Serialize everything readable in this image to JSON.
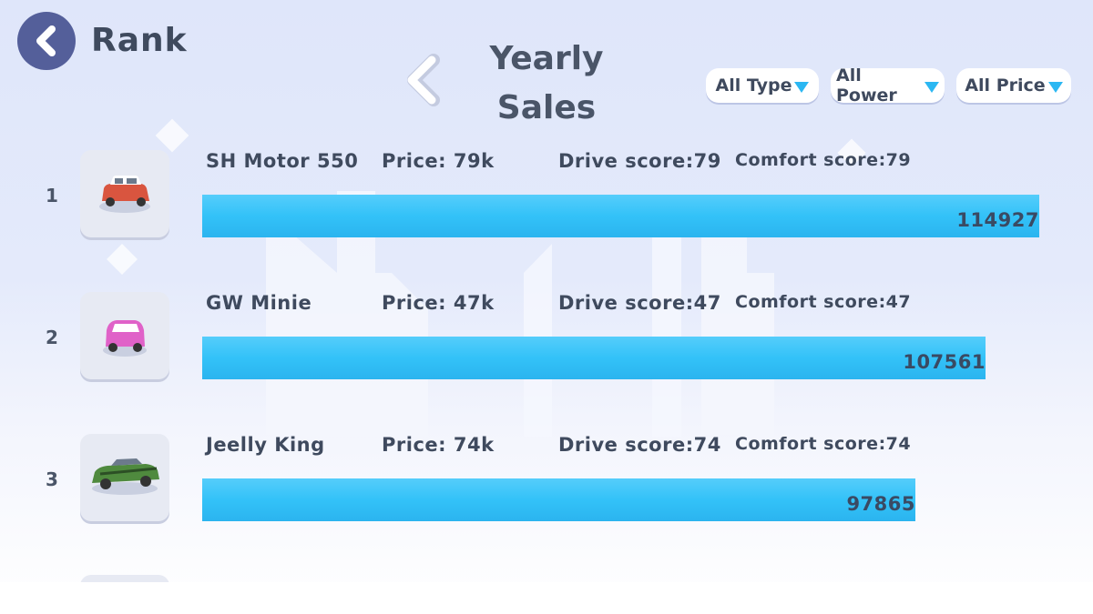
{
  "header": {
    "title": "Rank",
    "category_title": "Yearly Sales"
  },
  "filters": [
    {
      "label": "All Type"
    },
    {
      "label": "All Power"
    },
    {
      "label": "All Price"
    }
  ],
  "ranking": [
    {
      "rank": "1",
      "name": "SH Motor 550",
      "price": "Price: 79k",
      "drive": "Drive score:79",
      "comfort": "Comfort score:79",
      "sales": "114927",
      "sales_value": 114927,
      "car_icon": "red-mini-car-icon",
      "car_color": "#d9553f"
    },
    {
      "rank": "2",
      "name": "GW Minie",
      "price": "Price: 47k",
      "drive": "Drive score:47",
      "comfort": "Comfort score:47",
      "sales": "107561",
      "sales_value": 107561,
      "car_icon": "pink-micro-car-icon",
      "car_color": "#e062c8"
    },
    {
      "rank": "3",
      "name": "Jeelly King",
      "price": "Price: 74k",
      "drive": "Drive score:74",
      "comfort": "Comfort score:74",
      "sales": "97865",
      "sales_value": 97865,
      "car_icon": "green-muscle-car-icon",
      "car_color": "#4f8a3e"
    }
  ],
  "colors": {
    "bar": "#33c2f8",
    "back_button": "#545f9a",
    "text": "#3f4a5e"
  }
}
